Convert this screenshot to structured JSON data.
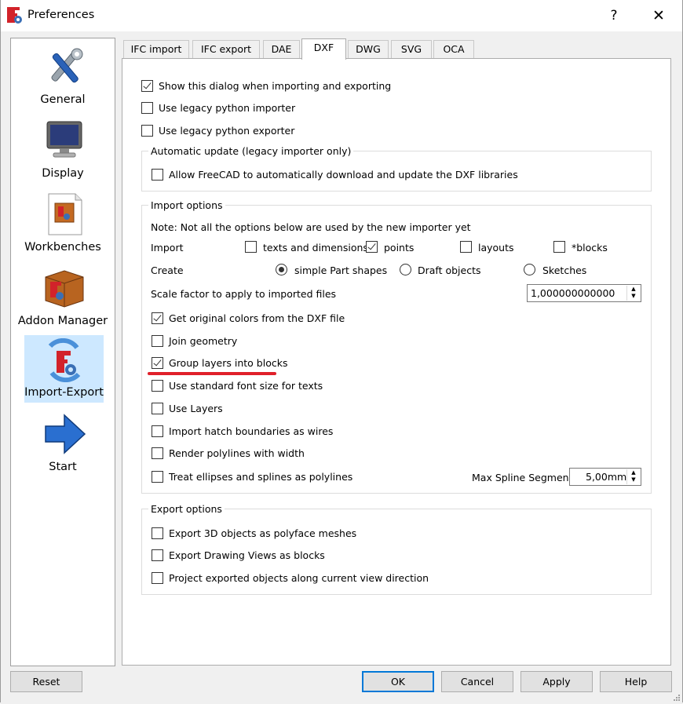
{
  "window": {
    "title": "Preferences",
    "help_glyph": "?",
    "close_glyph": "✕"
  },
  "pages": [
    {
      "label": "General",
      "icon": "tools-icon"
    },
    {
      "label": "Display",
      "icon": "monitor-icon"
    },
    {
      "label": "Workbenches",
      "icon": "workbenches-icon"
    },
    {
      "label": "Addon Manager",
      "icon": "addon-box-icon"
    },
    {
      "label": "Import-Export",
      "icon": "import-export-icon",
      "selected": true
    },
    {
      "label": "Start",
      "icon": "arrow-right-icon"
    }
  ],
  "tabs": [
    "IFC import",
    "IFC export",
    "DAE",
    "DXF",
    "DWG",
    "SVG",
    "OCA"
  ],
  "active_tab": "DXF",
  "top_options": [
    {
      "label": "Show this dialog when importing and exporting",
      "checked": true
    },
    {
      "label": "Use legacy python importer",
      "checked": false
    },
    {
      "label": "Use legacy python exporter",
      "checked": false
    }
  ],
  "auto_update": {
    "title": "Automatic update (legacy importer only)",
    "option": {
      "label": "Allow FreeCAD to automatically download and update the DXF libraries",
      "checked": false
    }
  },
  "import_options": {
    "title": "Import options",
    "note": "Note: Not all the options below are used by the new importer yet",
    "import_label": "Import",
    "import_items": [
      {
        "label": "texts and dimensions",
        "checked": false
      },
      {
        "label": "points",
        "checked": true
      },
      {
        "label": "layouts",
        "checked": false
      },
      {
        "label": "*blocks",
        "checked": false
      }
    ],
    "create_label": "Create",
    "create_items": [
      {
        "label": "simple Part shapes",
        "checked": true
      },
      {
        "label": "Draft objects",
        "checked": false
      },
      {
        "label": "Sketches",
        "checked": false
      }
    ],
    "scale_label": "Scale factor to apply to imported files",
    "scale_value": "1,000000000000",
    "options": [
      {
        "label": "Get original colors from the DXF file",
        "checked": true
      },
      {
        "label": "Join geometry",
        "checked": false
      },
      {
        "label": "Group layers into blocks",
        "checked": true
      },
      {
        "label": "Use standard font size for texts",
        "checked": false
      },
      {
        "label": "Use Layers",
        "checked": false
      },
      {
        "label": "Import hatch boundaries as wires",
        "checked": false
      },
      {
        "label": "Render polylines with width",
        "checked": false
      },
      {
        "label": "Treat ellipses and splines as polylines",
        "checked": false
      }
    ],
    "max_spline_label": "Max Spline Segment:",
    "max_spline_value": "5,00mm"
  },
  "export_options": {
    "title": "Export options",
    "options": [
      {
        "label": "Export 3D objects as polyface meshes",
        "checked": false
      },
      {
        "label": "Export Drawing Views as blocks",
        "checked": false
      },
      {
        "label": "Project exported objects along current view direction",
        "checked": false
      }
    ]
  },
  "buttons": {
    "reset": "Reset",
    "ok": "OK",
    "cancel": "Cancel",
    "apply": "Apply",
    "help": "Help"
  },
  "colors": {
    "selection": "#cde8ff",
    "annotation_underline": "#e0202a",
    "default_button_border": "#0078d7"
  }
}
